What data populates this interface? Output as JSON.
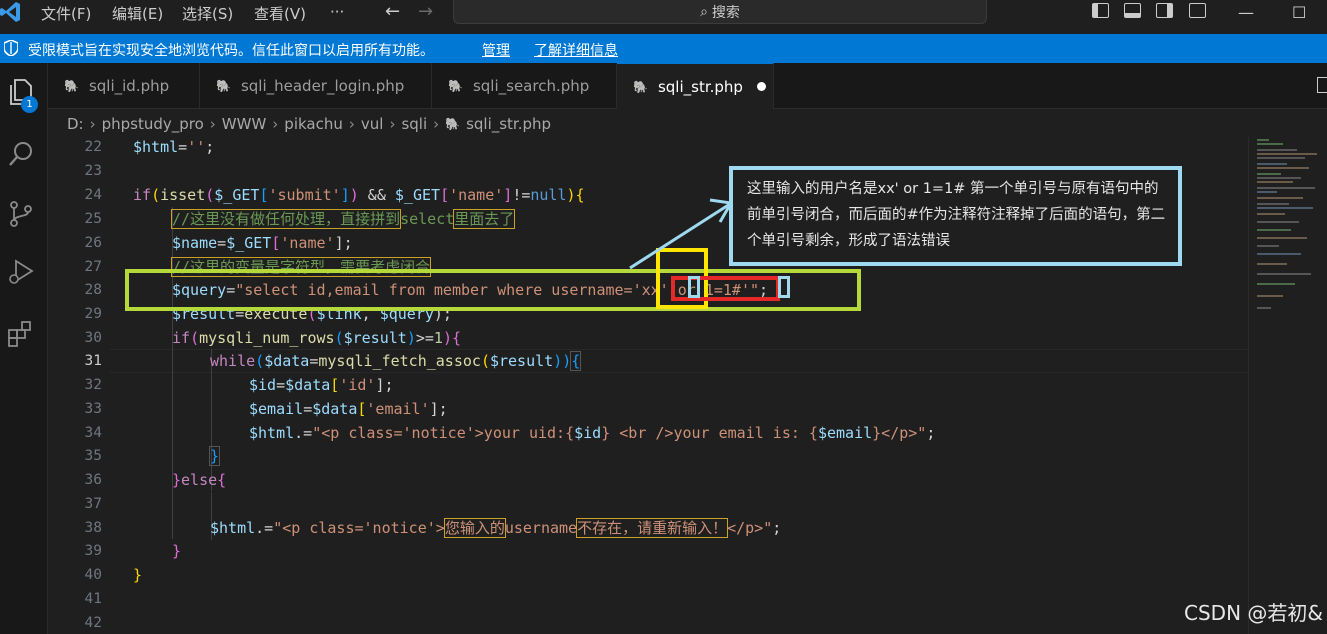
{
  "titlebar": {
    "menus": [
      "文件(F)",
      "编辑(E)",
      "选择(S)",
      "查看(V)",
      "···"
    ],
    "search_label": "搜索"
  },
  "banner": {
    "message": "受限模式旨在实现安全地浏览代码。信任此窗口以启用所有功能。",
    "manage": "管理",
    "learn_more": "了解详细信息"
  },
  "activity": {
    "badge": "1"
  },
  "tabs": [
    {
      "label": "sqli_id.php",
      "active": false
    },
    {
      "label": "sqli_header_login.php",
      "active": false
    },
    {
      "label": "sqli_search.php",
      "active": false
    },
    {
      "label": "sqli_str.php",
      "active": true,
      "modified": true
    }
  ],
  "breadcrumb": [
    "D:",
    "phpstudy_pro",
    "WWW",
    "pikachu",
    "vul",
    "sqli",
    "sqli_str.php"
  ],
  "editor": {
    "line_numbers": [
      "22",
      "23",
      "24",
      "25",
      "26",
      "27",
      "28",
      "29",
      "30",
      "31",
      "32",
      "33",
      "34",
      "35",
      "36",
      "37",
      "38",
      "39",
      "40",
      "41",
      "42"
    ],
    "current_line": "31",
    "code": {
      "l22": [
        "$html",
        "=",
        "''",
        ";"
      ],
      "l24": [
        "if",
        "(",
        "isset",
        "(",
        "$_GET",
        "[",
        "'submit'",
        "]",
        ")",
        " && ",
        "$_GET",
        "[",
        "'name'",
        "]",
        "!=",
        "null",
        ")",
        "{"
      ],
      "l25": [
        "//这里没有做任何处理，直接拼到",
        "select",
        "里面去了"
      ],
      "l26": [
        "$name",
        "=",
        "$_GET",
        "[",
        "'name'",
        "];"
      ],
      "l27": [
        "//这里的变量是字符型，需要考虑闭合"
      ],
      "l28": [
        "$query",
        "=",
        "\"select id,email from member where username='",
        "xx' or 1=1#",
        "'\"",
        ";"
      ],
      "l29": [
        "$result",
        "=",
        "execute",
        "(",
        "$link",
        ", ",
        "$query",
        ");"
      ],
      "l30": [
        "if",
        "(",
        "mysqli_num_rows",
        "(",
        "$result",
        ")",
        ">=",
        "1",
        "){"
      ],
      "l31": [
        "while",
        "(",
        "$data",
        "=",
        "mysqli_fetch_assoc",
        "(",
        "$result",
        "))",
        "{"
      ],
      "l32": [
        "$id",
        "=",
        "$data",
        "[",
        "'id'",
        "];"
      ],
      "l33": [
        "$email",
        "=",
        "$data",
        "[",
        "'email'",
        "];"
      ],
      "l34": [
        "$html",
        ".=",
        "\"<p class='notice'>your uid:{",
        "$id",
        "} <br />your email is: {",
        "$email",
        "}</p>\"",
        ";"
      ],
      "l35": [
        "}"
      ],
      "l36": [
        "}",
        "else",
        "{"
      ],
      "l38": [
        "$html",
        ".=",
        "\"<p class='notice'>",
        "您输入的",
        "username",
        "不存在，请重新输入！",
        "</p>\"",
        ";"
      ],
      "l39": [
        "}"
      ],
      "l40": [
        "}"
      ]
    }
  },
  "callout": {
    "text": "这里输入的用户名是xx' or 1=1#     第一个单引号与原有语句中的前单引号闭合，而后面的#作为注释符注释掉了后面的语句，第二个单引号剩余，形成了语法错误"
  },
  "watermark": "CSDN @若初&",
  "colors": {
    "banner": "#0078d4",
    "annotation_green": "#b5d83b",
    "annotation_yellow": "#ffe600",
    "annotation_red": "#e52828",
    "annotation_cyan": "#9fd9f0"
  }
}
